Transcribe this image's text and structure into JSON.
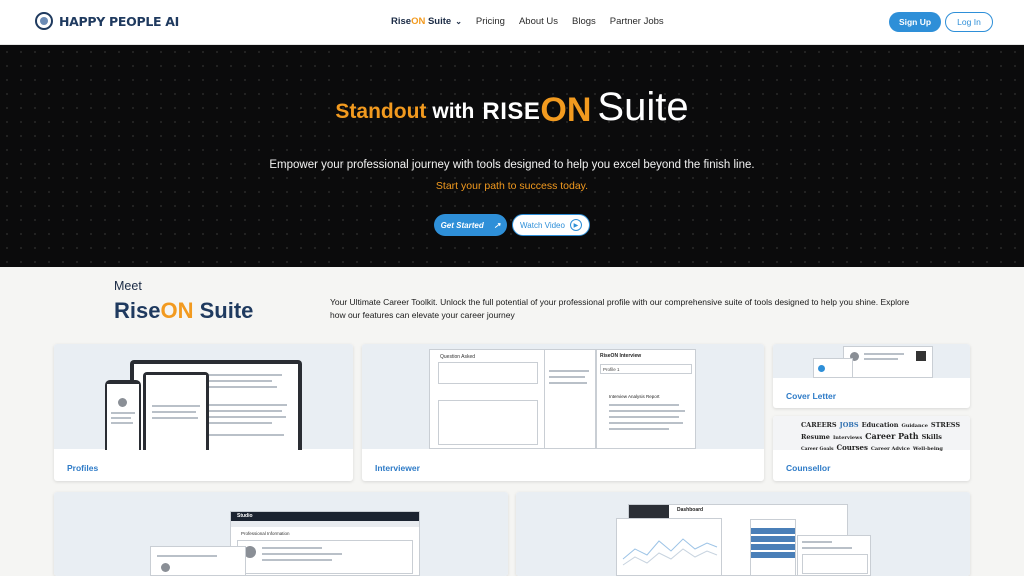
{
  "nav": {
    "brand": "HAPPY PEOPLE AI",
    "menu": [
      {
        "label_pre": "Rise",
        "label_on": "ON",
        "label_post": " Suite"
      },
      {
        "label": "Pricing"
      },
      {
        "label": "About Us"
      },
      {
        "label": "Blogs"
      },
      {
        "label": "Partner Jobs"
      }
    ],
    "signup": "Sign Up",
    "login": "Log In"
  },
  "hero": {
    "standout": "Standout",
    "with": "with",
    "rise": "RISE",
    "on": "ON",
    "suite": "Suite",
    "subtitle": "Empower your professional journey with tools designed to help you excel beyond the finish line.",
    "tagline": "Start your path to success today.",
    "get_started": "Get Started",
    "watch_video": "Watch Video"
  },
  "meet": {
    "label": "Meet",
    "title_pre": "Rise",
    "title_on": "ON",
    "title_post": " Suite",
    "description": "Your Ultimate Career Toolkit. Unlock the full potential of your professional profile with our comprehensive suite of tools designed to help you shine. Explore how our features can elevate your career journey"
  },
  "cards": {
    "profiles": "Profiles",
    "interviewer": "Interviewer",
    "cover_letter": "Cover Letter",
    "counsellor": "Counsellor",
    "interview_q": "Question Asked",
    "interview_title": "RiseON Interview",
    "interview_profile": "Profile 1",
    "interview_report": "Interview Analysis Report",
    "studio": "Studio",
    "dashboard": "Dashboard",
    "prof_info": "Professional Information",
    "counsellor_words": [
      "CAREERS",
      "JOBS",
      "Education",
      "Guidance",
      "STRESS",
      "Resume",
      "Interviews",
      "Career Path",
      "Skills",
      "Career Goals",
      "Courses",
      "Career Advice",
      "Well-being"
    ]
  },
  "colors": {
    "accent_blue": "#2e8fd8",
    "accent_orange": "#f29a1f",
    "navy": "#1f3a5f",
    "hero_bg": "#0b0b0c"
  }
}
